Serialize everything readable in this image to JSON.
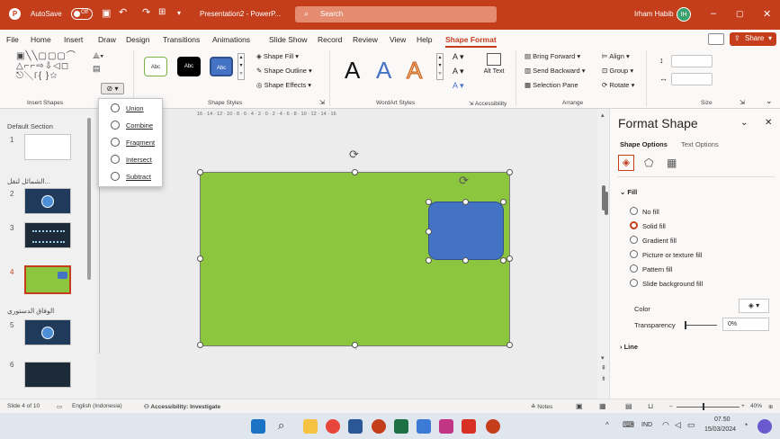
{
  "titlebar": {
    "autosave": "AutoSave",
    "autosave_state": "Off",
    "filename": "Presentation2 - PowerP...",
    "search": "Search",
    "user": "Irham Habib",
    "initials": "IH"
  },
  "menu": [
    "File",
    "Home",
    "Insert",
    "Draw",
    "Design",
    "Transitions",
    "Animations",
    "Slide Show",
    "Record",
    "Review",
    "View",
    "Help",
    "Shape Format"
  ],
  "share": "Share",
  "ribbon": {
    "insert_shapes": "Insert Shapes",
    "shape_styles": "Shape Styles",
    "style_samples": [
      "Abc",
      "Abc",
      "Abc"
    ],
    "shape_fill": "Shape Fill",
    "shape_outline": "Shape Outline",
    "shape_effects": "Shape Effects",
    "wordart_styles": "WordArt Styles",
    "wordart_letter": "A",
    "alt_text": "Alt Text",
    "accessibility": "Accessibility",
    "bring_forward": "Bring Forward",
    "send_backward": "Send Backward",
    "selection_pane": "Selection Pane",
    "align": "Align",
    "group": "Group",
    "rotate": "Rotate",
    "arrange": "Arrange",
    "size": "Size"
  },
  "merge_menu": [
    "Union",
    "Combine",
    "Fragment",
    "Intersect",
    "Subtract"
  ],
  "thumbnails": {
    "default_section": "Default Section",
    "section2": "الشمائل لنقل...",
    "section3": "الوفاق الدستوري",
    "slides": [
      "1",
      "2",
      "3",
      "4",
      "5",
      "6"
    ]
  },
  "ruler": "16 · 14 · 12 · 10 · 8 · 6 · 4 · 2 · 0 · 2 · 4 · 6 · 8 · 10 · 12 · 14 · 16",
  "format_pane": {
    "title": "Format Shape",
    "tab_shape": "Shape Options",
    "tab_text": "Text Options",
    "fill": "Fill",
    "options": [
      "No fill",
      "Solid fill",
      "Gradient fill",
      "Picture or texture fill",
      "Pattern fill",
      "Slide background fill"
    ],
    "selected_option": "Solid fill",
    "color": "Color",
    "transparency": "Transparency",
    "transparency_value": "0%",
    "line": "Line"
  },
  "status": {
    "slide": "Slide 4 of 10",
    "language": "English (Indonesia)",
    "accessibility": "Accessibility: Investigate",
    "notes": "Notes",
    "zoom": "40%"
  },
  "taskbar": {
    "lang": "IND",
    "time": "07.50",
    "date": "15/03/2024"
  },
  "colors": {
    "accent": "#c43e1c",
    "green_shape": "#8cc63f",
    "blue_shape": "#4472c4"
  }
}
